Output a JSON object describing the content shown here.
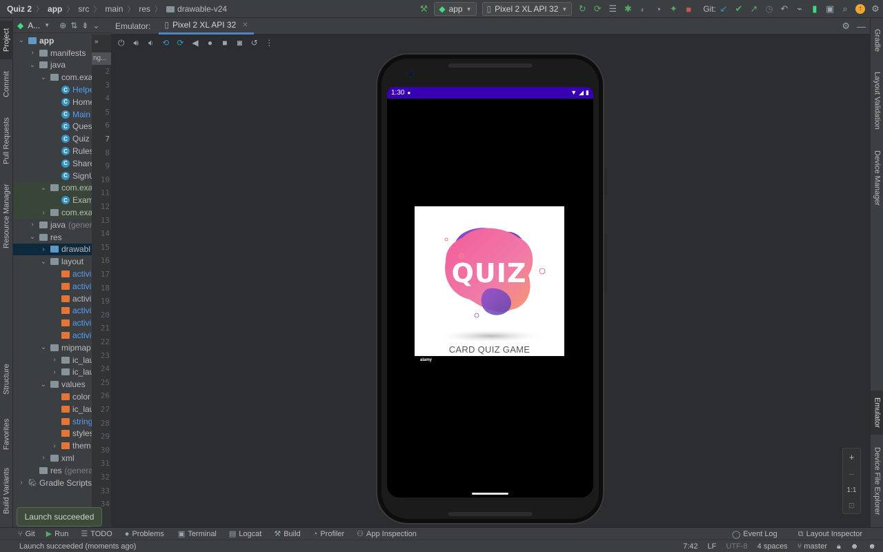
{
  "breadcrumb": {
    "project": "Quiz 2",
    "module": "app",
    "src": "src",
    "main": "main",
    "res": "res",
    "folder": "drawable-v24"
  },
  "toolbar": {
    "run_config": "app",
    "device": "Pixel 2 XL API 32",
    "git_label": "Git:"
  },
  "left_tabs": {
    "project": "Project",
    "commit": "Commit",
    "pull_requests": "Pull Requests",
    "resource_manager": "Resource Manager",
    "structure": "Structure",
    "favorites": "Favorites",
    "build_variants": "Build Variants"
  },
  "right_tabs": {
    "gradle": "Gradle",
    "layout_validation": "Layout Validation",
    "device_manager": "Device Manager",
    "emulator": "Emulator",
    "device_file_explorer": "Device File Explorer"
  },
  "project_panel": {
    "title": "A...",
    "items": [
      {
        "label": "app",
        "indent": 0
      },
      {
        "label": "manifests",
        "indent": 1
      },
      {
        "label": "java",
        "indent": 1
      },
      {
        "label": "com.exa",
        "indent": 2
      },
      {
        "label": "Helpe",
        "indent": 3
      },
      {
        "label": "Home",
        "indent": 3
      },
      {
        "label": "Main",
        "indent": 3
      },
      {
        "label": "Ques",
        "indent": 3
      },
      {
        "label": "Quiz",
        "indent": 3
      },
      {
        "label": "Rules",
        "indent": 3
      },
      {
        "label": "Share",
        "indent": 3
      },
      {
        "label": "SignU",
        "indent": 3
      },
      {
        "label": "com.exa",
        "indent": 2
      },
      {
        "label": "Exam",
        "indent": 3
      },
      {
        "label": "com.exa",
        "indent": 2
      },
      {
        "label": "java",
        "suffix": "(gener",
        "indent": 1
      },
      {
        "label": "res",
        "indent": 1
      },
      {
        "label": "drawabl",
        "indent": 2
      },
      {
        "label": "layout",
        "indent": 2
      },
      {
        "label": "activi",
        "indent": 3
      },
      {
        "label": "activi",
        "indent": 3
      },
      {
        "label": "activi",
        "indent": 3
      },
      {
        "label": "activi",
        "indent": 3
      },
      {
        "label": "activi",
        "indent": 3
      },
      {
        "label": "activi",
        "indent": 3
      },
      {
        "label": "mipmap",
        "indent": 2
      },
      {
        "label": "ic_lau",
        "indent": 3
      },
      {
        "label": "ic_lau",
        "indent": 3
      },
      {
        "label": "values",
        "indent": 2
      },
      {
        "label": "color",
        "indent": 3
      },
      {
        "label": "ic_lau",
        "indent": 3
      },
      {
        "label": "string",
        "indent": 3
      },
      {
        "label": "styles",
        "indent": 3
      },
      {
        "label": "them",
        "indent": 3
      },
      {
        "label": "xml",
        "indent": 2
      },
      {
        "label": "res",
        "suffix": "(genera",
        "indent": 1
      },
      {
        "label": "Gradle Scripts",
        "indent": 0
      }
    ]
  },
  "gutter": {
    "tab_stub": "ng...",
    "line_numbers": [
      "2",
      "3",
      "4",
      "5",
      "6",
      "7",
      "8",
      "9",
      "10",
      "11",
      "12",
      "13",
      "14",
      "15",
      "16",
      "17",
      "18",
      "19",
      "20",
      "21",
      "22",
      "23",
      "24",
      "25",
      "26",
      "27",
      "28",
      "29",
      "30",
      "31",
      "32",
      "33",
      "34"
    ],
    "current_line": "7"
  },
  "emulator": {
    "label": "Emulator:",
    "tab": "Pixel 2 XL API 32",
    "status_time": "1:30",
    "image_title": "QUIZ",
    "image_subtitle": "CARD QUIZ GAME",
    "image_brand": "alamy"
  },
  "zoom": {
    "plus": "+",
    "minus": "−",
    "one_to_one": "1:1"
  },
  "toast": {
    "text": "Launch succeeded"
  },
  "bottom_tools": {
    "git": "Git",
    "run": "Run",
    "todo": "TODO",
    "problems": "Problems",
    "terminal": "Terminal",
    "logcat": "Logcat",
    "build": "Build",
    "profiler": "Profiler",
    "app_inspection": "App Inspection",
    "event_log": "Event Log",
    "layout_inspector": "Layout Inspector"
  },
  "status": {
    "message": "Launch succeeded (moments ago)",
    "position": "7:42",
    "line_sep": "LF",
    "encoding": "UTF-8",
    "indent": "4 spaces",
    "branch": "master"
  },
  "colors": {
    "status_bar": "#3700b3",
    "accent_tab": "#4a88c7",
    "quiz_pink": "#f25c9a",
    "quiz_purple": "#6a4bc4",
    "quiz_orange": "#f59b6a"
  }
}
